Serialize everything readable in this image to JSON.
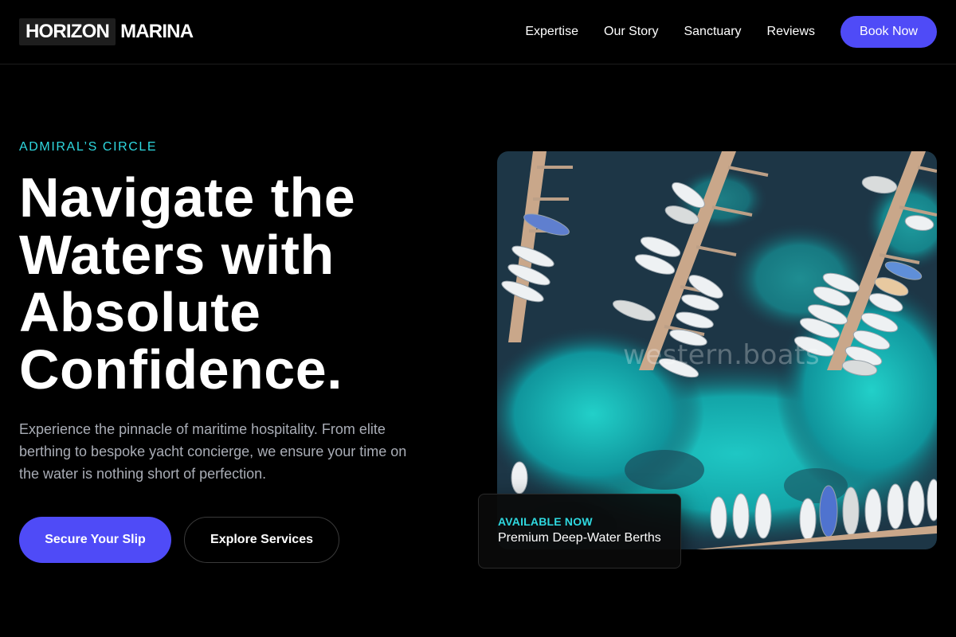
{
  "brand": {
    "logo_part1": "HORIZON",
    "logo_part2": "MARINA"
  },
  "nav": {
    "links": [
      "Expertise",
      "Our Story",
      "Sanctuary",
      "Reviews"
    ],
    "cta_label": "Book Now"
  },
  "hero": {
    "eyebrow": "ADMIRAL’S CIRCLE",
    "headline_lines": [
      "Navigate the",
      "Waters with",
      "Absolute",
      "Confidence."
    ],
    "description": "Experience the pinnacle of maritime hospitality. From elite berthing to bespoke yacht concierge, we ensure your time on the water is nothing short of perfection.",
    "primary_cta": "Secure Your Slip",
    "secondary_cta": "Explore Services",
    "image_watermark": "western.boats"
  },
  "availability": {
    "label": "AVAILABLE NOW",
    "title": "Premium Deep-Water Berths"
  },
  "colors": {
    "background": "#000000",
    "accent": "#4f4bf7",
    "eyebrow": "#2fd9e0",
    "muted_text": "#a9adb6"
  },
  "icons": {
    "hero_image": "aerial-marina-photo"
  }
}
